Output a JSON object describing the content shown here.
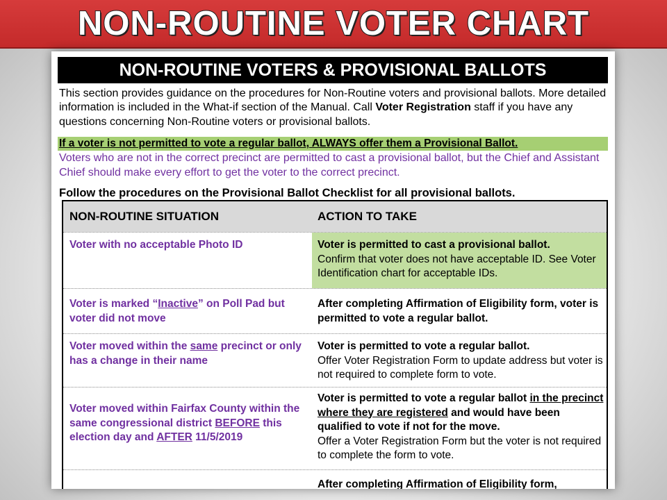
{
  "banner": {
    "title": "NON-ROUTINE VOTER CHART"
  },
  "doc": {
    "header": "NON-ROUTINE VOTERS & PROVISIONAL BALLOTS",
    "intro": {
      "part1": "This section provides guidance on the procedures for Non-Routine voters and provisional ballots. More detailed information is included in the What-if section of the Manual. Call ",
      "bold": "Voter Registration",
      "part2": " staff if you have any questions concerning Non-Routine voters or provisional ballots."
    },
    "highlight": "If a voter is not permitted to vote a regular ballot, ALWAYS offer them a Provisional Ballot.",
    "purple_note": "Voters who are not in the correct precinct are permitted to cast a provisional ballot, but the Chief and Assistant Chief should make every effort to get the voter to the correct precinct.",
    "follow": "Follow the procedures on the Provisional Ballot Checklist for all provisional ballots.",
    "table": {
      "headers": {
        "situation": "NON-ROUTINE SITUATION",
        "action": "ACTION TO TAKE"
      },
      "rows": [
        {
          "situation": "Voter with no acceptable Photo ID",
          "action_bold": "Voter is permitted to cast a provisional ballot.",
          "action_normal": "Confirm that voter does not have acceptable ID. See Voter Identification chart for acceptable IDs."
        },
        {
          "situation_pre": "Voter is marked “",
          "situation_u": "Inactive",
          "situation_post": "” on Poll Pad but voter did not move",
          "action_bold": "After completing Affirmation of Eligibility form, voter is permitted to vote a regular ballot."
        },
        {
          "situation_pre": "Voter moved within the ",
          "situation_u": "same",
          "situation_post": " precinct or only has a change in their name",
          "action_bold": "Voter is permitted to vote a regular ballot.",
          "action_normal": "Offer Voter Registration Form to update address but voter is not required to complete form to vote."
        },
        {
          "situation_pre": "Voter moved within Fairfax County within the same congressional district ",
          "situation_u1": "BEFORE",
          "situation_mid": " this election day and ",
          "situation_u2": "AFTER",
          "situation_post": " 11/5/2019",
          "action_bold_pre": "Voter is permitted to vote a regular ballot ",
          "action_bold_u": "in the precinct where they are registered",
          "action_bold_post": " and would have been qualified to vote if not for the move.",
          "action_normal": "Offer a Voter Registration Form but the voter is not required to complete the form to vote."
        },
        {
          "action_bold": "After completing Affirmation of Eligibility form,"
        }
      ]
    }
  }
}
